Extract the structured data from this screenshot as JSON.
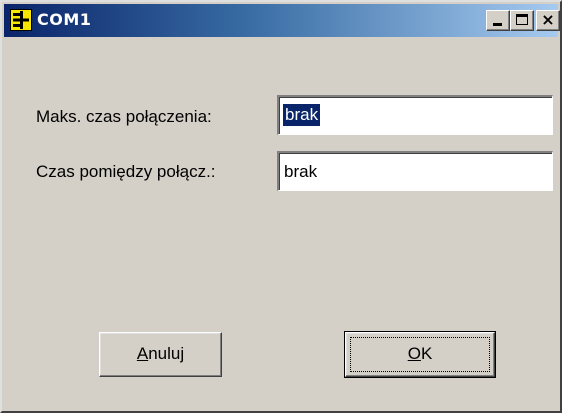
{
  "window": {
    "title": "COM1",
    "icon": "serial-port-icon",
    "controls": {
      "minimize_icon": "minimize-icon",
      "maximize_icon": "maximize-icon",
      "close_glyph": "×"
    }
  },
  "form": {
    "max_time": {
      "label": "Maks. czas połączenia:",
      "value": "brak"
    },
    "between_time": {
      "label": "Czas pomiędzy połącz.:",
      "value": "brak"
    }
  },
  "buttons": {
    "cancel": {
      "mnemonic": "A",
      "rest": "nuluj"
    },
    "ok": {
      "mnemonic": "O",
      "rest": "K"
    }
  },
  "colors": {
    "face": "#d4d0c8",
    "title_start": "#0a246a",
    "title_end": "#a6caf0",
    "selection": "#0a246a",
    "icon_yellow": "#f8e800"
  }
}
